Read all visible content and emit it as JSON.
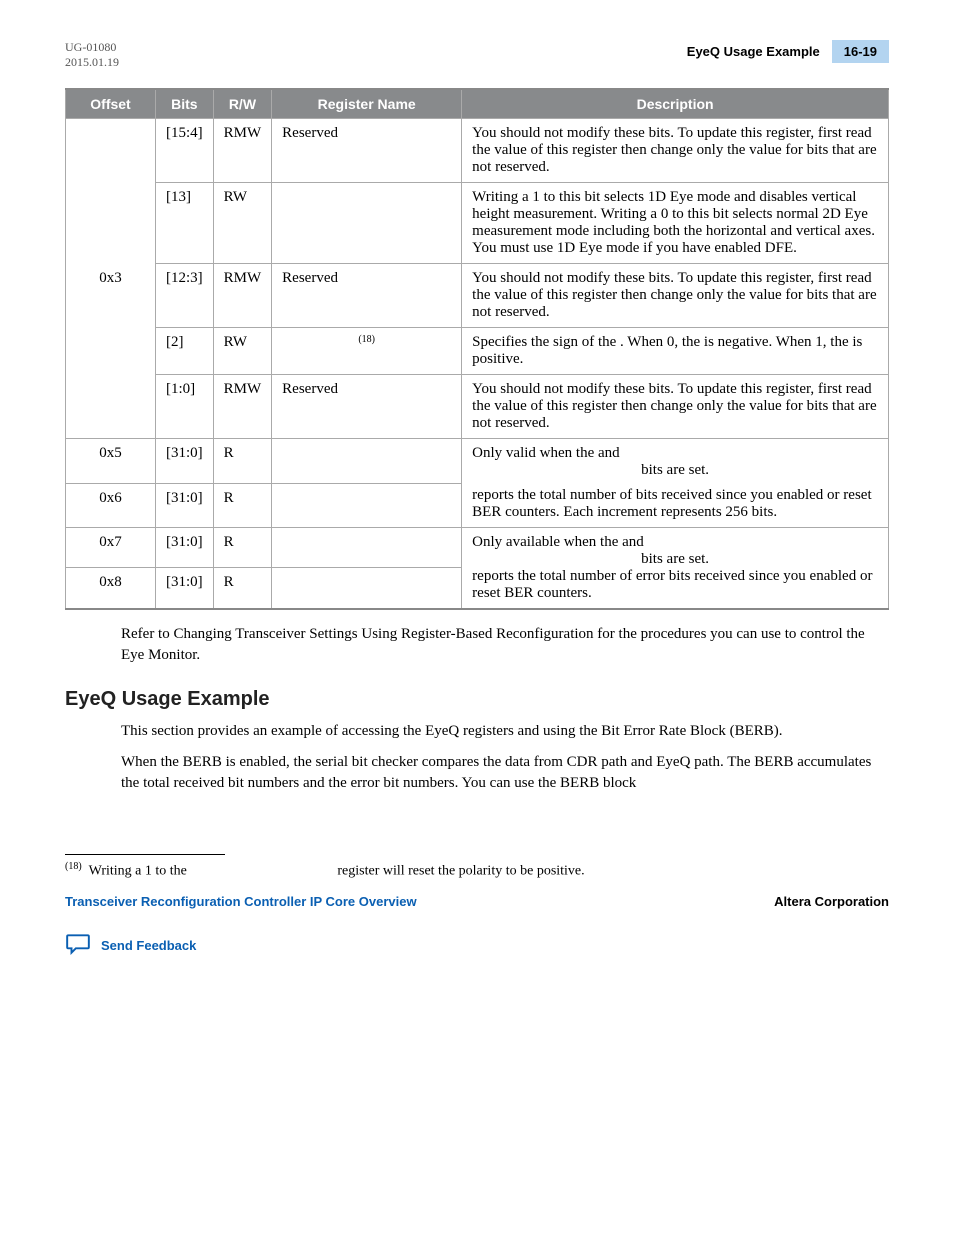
{
  "header": {
    "doc_id": "UG-01080",
    "date": "2015.01.19",
    "section_title": "EyeQ Usage Example",
    "page_number": "16-19"
  },
  "table": {
    "headers": [
      "Offset",
      "Bits",
      "R/W",
      "Register Name",
      "Description"
    ],
    "rows": [
      {
        "offset": "",
        "bits": "[15:4]",
        "rw": "RMW",
        "regname": "Reserved",
        "desc": "You should not modify these bits. To update this register, first read the value of this register then change only the value for bits that are not reserved."
      },
      {
        "offset": "",
        "bits": "[13]",
        "rw": "RW",
        "regname": "",
        "desc": "Writing a 1 to this bit selects 1D Eye mode and disables vertical height measurement. Writing a 0 to this bit selects normal 2D Eye measurement mode including both the horizontal and vertical axes. You must use 1D Eye mode if you have enabled DFE."
      },
      {
        "offset": "0x3",
        "bits": "[12:3]",
        "rw": "RMW",
        "regname": "Reserved",
        "desc": "You should not modify these bits. To update this register, first read the value of this register then change only the value for bits that are not reserved."
      },
      {
        "offset": "",
        "bits": "[2]",
        "rw": "RW",
        "regname_sup": "(18)",
        "desc": "Specifies the sign of the                               . When 0, the                                is negative. When 1, the                                is positive."
      },
      {
        "offset": "",
        "bits": "[1:0]",
        "rw": "RMW",
        "regname": "Reserved",
        "desc": "You should not modify these bits. To update this register, first read the value of this register then change only the value for bits that are not reserved."
      },
      {
        "offset": "0x5",
        "bits": "[31:0]",
        "rw": "R",
        "regname": "",
        "desc_a": "Only valid when the                            and"
      },
      {
        "offset": "0x6",
        "bits": "[31:0]",
        "rw": "R",
        "regname": "",
        "desc_b": "             bits are set.",
        "desc_c": "                                  reports the total number of bits received since you enabled or reset BER counters. Each increment represents 256 bits."
      },
      {
        "offset": "0x7",
        "bits": "[31:0]",
        "rw": "R",
        "regname": "",
        "desc_a": "Only available when the                            and"
      },
      {
        "offset": "0x8",
        "bits": "[31:0]",
        "rw": "R",
        "regname": "",
        "desc_b": "                   bits are set.",
        "desc_c": "reports the total number of error bits received since you enabled or reset BER counters."
      }
    ]
  },
  "body": {
    "p1": "Refer to Changing Transceiver Settings Using Register-Based Reconfiguration for the procedures you can use to control the Eye Monitor.",
    "heading": "EyeQ Usage Example",
    "p2": "This section provides an example of accessing the EyeQ registers and using the Bit Error Rate Block (BERB).",
    "p3": "When the BERB is enabled, the serial bit checker compares the data from CDR path and EyeQ path. The BERB accumulates the total received bit numbers and the error bit numbers. You can use the BERB block"
  },
  "footnote": {
    "marker": "(18)",
    "text_a": "Writing a 1 to the",
    "text_b": "register will reset the polarity to be positive."
  },
  "footer": {
    "left": "Transceiver Reconfiguration Controller IP Core Overview",
    "right": "Altera Corporation",
    "feedback": "Send Feedback"
  }
}
